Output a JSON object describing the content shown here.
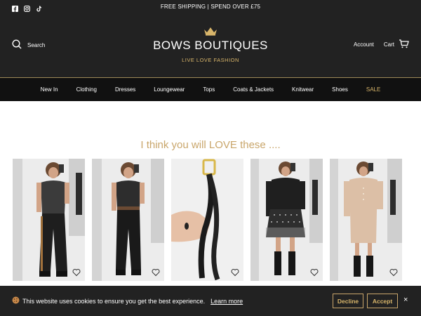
{
  "topbar": {
    "promo": "FREE SHIPPING | SPEND OVER £75",
    "social": [
      "facebook-icon",
      "instagram-icon",
      "tiktok-icon"
    ]
  },
  "header": {
    "search_label": "Search",
    "brand": "BOWS BOUTIQUES",
    "tagline": "LIVE  LOVE  FASHION",
    "account_label": "Account",
    "cart_label": "Cart"
  },
  "nav": {
    "items": [
      "New In",
      "Clothing",
      "Dresses",
      "Loungewear",
      "Tops",
      "Coats & Jackets",
      "Knitwear",
      "Shoes",
      "SALE"
    ]
  },
  "main": {
    "heading": "I think you will LOVE these ...."
  },
  "products": [
    {
      "title": ""
    },
    {
      "title": ""
    },
    {
      "title": ""
    },
    {
      "title": ""
    },
    {
      "title": ""
    }
  ],
  "cookie": {
    "message": "This website uses cookies to ensure you get the best experience.",
    "link": "Learn more",
    "decline": "Decline",
    "accept": "Accept",
    "close": "×"
  },
  "colors": {
    "header_bg": "#222222",
    "nav_bg": "#111111",
    "accent_gold": "#c9a66b"
  }
}
